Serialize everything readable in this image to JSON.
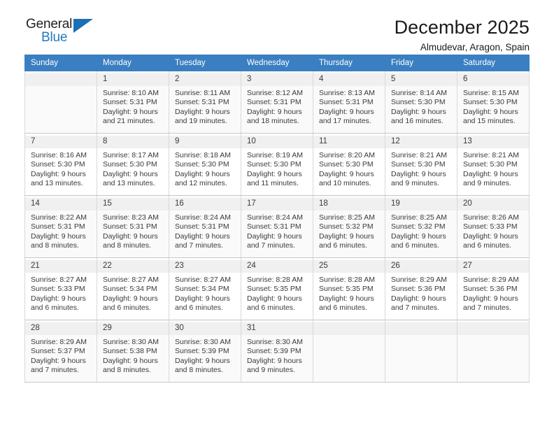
{
  "brand": {
    "name_part1": "General",
    "name_part2": "Blue",
    "accent_color": "#1f7ac4"
  },
  "header": {
    "title": "December 2025",
    "subtitle": "Almudevar, Aragon, Spain"
  },
  "calendar": {
    "header_bg": "#3a7fc1",
    "weekday_headers": [
      "Sunday",
      "Monday",
      "Tuesday",
      "Wednesday",
      "Thursday",
      "Friday",
      "Saturday"
    ],
    "weeks": [
      [
        {
          "day": "",
          "detail": ""
        },
        {
          "day": "1",
          "detail": "Sunrise: 8:10 AM\nSunset: 5:31 PM\nDaylight: 9 hours\nand 21 minutes."
        },
        {
          "day": "2",
          "detail": "Sunrise: 8:11 AM\nSunset: 5:31 PM\nDaylight: 9 hours\nand 19 minutes."
        },
        {
          "day": "3",
          "detail": "Sunrise: 8:12 AM\nSunset: 5:31 PM\nDaylight: 9 hours\nand 18 minutes."
        },
        {
          "day": "4",
          "detail": "Sunrise: 8:13 AM\nSunset: 5:31 PM\nDaylight: 9 hours\nand 17 minutes."
        },
        {
          "day": "5",
          "detail": "Sunrise: 8:14 AM\nSunset: 5:30 PM\nDaylight: 9 hours\nand 16 minutes."
        },
        {
          "day": "6",
          "detail": "Sunrise: 8:15 AM\nSunset: 5:30 PM\nDaylight: 9 hours\nand 15 minutes."
        }
      ],
      [
        {
          "day": "7",
          "detail": "Sunrise: 8:16 AM\nSunset: 5:30 PM\nDaylight: 9 hours\nand 13 minutes."
        },
        {
          "day": "8",
          "detail": "Sunrise: 8:17 AM\nSunset: 5:30 PM\nDaylight: 9 hours\nand 13 minutes."
        },
        {
          "day": "9",
          "detail": "Sunrise: 8:18 AM\nSunset: 5:30 PM\nDaylight: 9 hours\nand 12 minutes."
        },
        {
          "day": "10",
          "detail": "Sunrise: 8:19 AM\nSunset: 5:30 PM\nDaylight: 9 hours\nand 11 minutes."
        },
        {
          "day": "11",
          "detail": "Sunrise: 8:20 AM\nSunset: 5:30 PM\nDaylight: 9 hours\nand 10 minutes."
        },
        {
          "day": "12",
          "detail": "Sunrise: 8:21 AM\nSunset: 5:30 PM\nDaylight: 9 hours\nand 9 minutes."
        },
        {
          "day": "13",
          "detail": "Sunrise: 8:21 AM\nSunset: 5:30 PM\nDaylight: 9 hours\nand 9 minutes."
        }
      ],
      [
        {
          "day": "14",
          "detail": "Sunrise: 8:22 AM\nSunset: 5:31 PM\nDaylight: 9 hours\nand 8 minutes."
        },
        {
          "day": "15",
          "detail": "Sunrise: 8:23 AM\nSunset: 5:31 PM\nDaylight: 9 hours\nand 8 minutes."
        },
        {
          "day": "16",
          "detail": "Sunrise: 8:24 AM\nSunset: 5:31 PM\nDaylight: 9 hours\nand 7 minutes."
        },
        {
          "day": "17",
          "detail": "Sunrise: 8:24 AM\nSunset: 5:31 PM\nDaylight: 9 hours\nand 7 minutes."
        },
        {
          "day": "18",
          "detail": "Sunrise: 8:25 AM\nSunset: 5:32 PM\nDaylight: 9 hours\nand 6 minutes."
        },
        {
          "day": "19",
          "detail": "Sunrise: 8:25 AM\nSunset: 5:32 PM\nDaylight: 9 hours\nand 6 minutes."
        },
        {
          "day": "20",
          "detail": "Sunrise: 8:26 AM\nSunset: 5:33 PM\nDaylight: 9 hours\nand 6 minutes."
        }
      ],
      [
        {
          "day": "21",
          "detail": "Sunrise: 8:27 AM\nSunset: 5:33 PM\nDaylight: 9 hours\nand 6 minutes."
        },
        {
          "day": "22",
          "detail": "Sunrise: 8:27 AM\nSunset: 5:34 PM\nDaylight: 9 hours\nand 6 minutes."
        },
        {
          "day": "23",
          "detail": "Sunrise: 8:27 AM\nSunset: 5:34 PM\nDaylight: 9 hours\nand 6 minutes."
        },
        {
          "day": "24",
          "detail": "Sunrise: 8:28 AM\nSunset: 5:35 PM\nDaylight: 9 hours\nand 6 minutes."
        },
        {
          "day": "25",
          "detail": "Sunrise: 8:28 AM\nSunset: 5:35 PM\nDaylight: 9 hours\nand 6 minutes."
        },
        {
          "day": "26",
          "detail": "Sunrise: 8:29 AM\nSunset: 5:36 PM\nDaylight: 9 hours\nand 7 minutes."
        },
        {
          "day": "27",
          "detail": "Sunrise: 8:29 AM\nSunset: 5:36 PM\nDaylight: 9 hours\nand 7 minutes."
        }
      ],
      [
        {
          "day": "28",
          "detail": "Sunrise: 8:29 AM\nSunset: 5:37 PM\nDaylight: 9 hours\nand 7 minutes."
        },
        {
          "day": "29",
          "detail": "Sunrise: 8:30 AM\nSunset: 5:38 PM\nDaylight: 9 hours\nand 8 minutes."
        },
        {
          "day": "30",
          "detail": "Sunrise: 8:30 AM\nSunset: 5:39 PM\nDaylight: 9 hours\nand 8 minutes."
        },
        {
          "day": "31",
          "detail": "Sunrise: 8:30 AM\nSunset: 5:39 PM\nDaylight: 9 hours\nand 9 minutes."
        },
        {
          "day": "",
          "detail": ""
        },
        {
          "day": "",
          "detail": ""
        },
        {
          "day": "",
          "detail": ""
        }
      ]
    ]
  }
}
